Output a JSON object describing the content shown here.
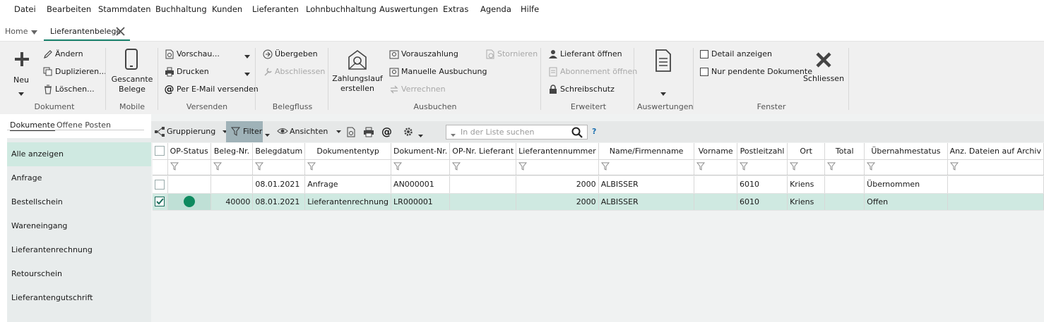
{
  "menubar": {
    "items": [
      "Datei",
      "Bearbeiten",
      "Stammdaten",
      "Buchhaltung",
      "Kunden",
      "Lieferanten",
      "Lohnbuchhaltung",
      "Auswertungen",
      "Extras",
      "Agenda",
      "Hilfe"
    ]
  },
  "tabs": {
    "home": "Home",
    "active": "Lieferantenbelege"
  },
  "ribbon": {
    "neu": "Neu",
    "aendern": "Ändern",
    "duplizieren": "Duplizieren...",
    "loeschen": "Löschen...",
    "gescannte": "Gescannte",
    "belege": "Belege",
    "vorschau": "Vorschau...",
    "drucken": "Drucken",
    "email": "Per E-Mail versenden",
    "uebergeben": "Übergeben",
    "abschliessen": "Abschliessen",
    "zahlungslauf1": "Zahlungslauf",
    "zahlungslauf2": "erstellen",
    "vorauszahlung": "Vorauszahlung",
    "manuelle": "Manuelle Ausbuchung",
    "verrechnen": "Verrechnen",
    "stornieren": "Stornieren",
    "lieferant_oeffnen": "Lieferant öffnen",
    "abonnement": "Abonnement öffnen",
    "schreibschutz": "Schreibschutz",
    "detail": "Detail anzeigen",
    "pendente": "Nur pendente Dokumente",
    "schliessen": "Schliessen",
    "groups": {
      "dokument": "Dokument",
      "mobile": "Mobile",
      "versenden": "Versenden",
      "belegfluss": "Belegfluss",
      "ausbuchen": "Ausbuchen",
      "erweitert": "Erweitert",
      "auswertungen": "Auswertungen",
      "fenster": "Fenster"
    }
  },
  "leftpane": {
    "subtab_dokumente": "Dokumente",
    "subtab_offene": "Offene Posten",
    "items": [
      "Alle anzeigen",
      "Anfrage",
      "Bestellschein",
      "Wareneingang",
      "Lieferantenrechnung",
      "Retourschein",
      "Lieferantengutschrift"
    ]
  },
  "toolbar": {
    "gruppierung": "Gruppierung",
    "filter": "Filter",
    "ansichten": "Ansichten",
    "search_placeholder": "In der Liste suchen",
    "help": "?"
  },
  "grid": {
    "columns": [
      "OP-Status",
      "Beleg-Nr.",
      "Belegdatum",
      "Dokumententyp",
      "Dokument-Nr.",
      "OP-Nr. Lieferant",
      "Lieferantennummer",
      "Name/Firmenname",
      "Vorname",
      "Postleitzahl",
      "Ort",
      "Total",
      "Übernahmestatus",
      "Anz. Dateien auf Archiv"
    ],
    "rows": [
      {
        "checked": false,
        "status": "",
        "beleg": "",
        "datum": "08.01.2021",
        "typ": "Anfrage",
        "dok": "AN000001",
        "opnr": "",
        "lnr": "2000",
        "name": "ALBISSER",
        "vorname": "",
        "plz": "6010",
        "ort": "Kriens",
        "total": "",
        "uebernahme": "Übernommen",
        "anz": ""
      },
      {
        "checked": true,
        "status": "green",
        "beleg": "40000",
        "datum": "08.01.2021",
        "typ": "Lieferantenrechnung",
        "dok": "LR000001",
        "opnr": "",
        "lnr": "2000",
        "name": "ALBISSER",
        "vorname": "",
        "plz": "6010",
        "ort": "Kriens",
        "total": "",
        "uebernahme": "Offen",
        "anz": ""
      }
    ]
  },
  "colors": {
    "ribbon_bg": "#f0f0f0",
    "selection": "#cfe9e1",
    "status_green": "#0e8a5f",
    "filter_active": "#9fb2b8"
  }
}
